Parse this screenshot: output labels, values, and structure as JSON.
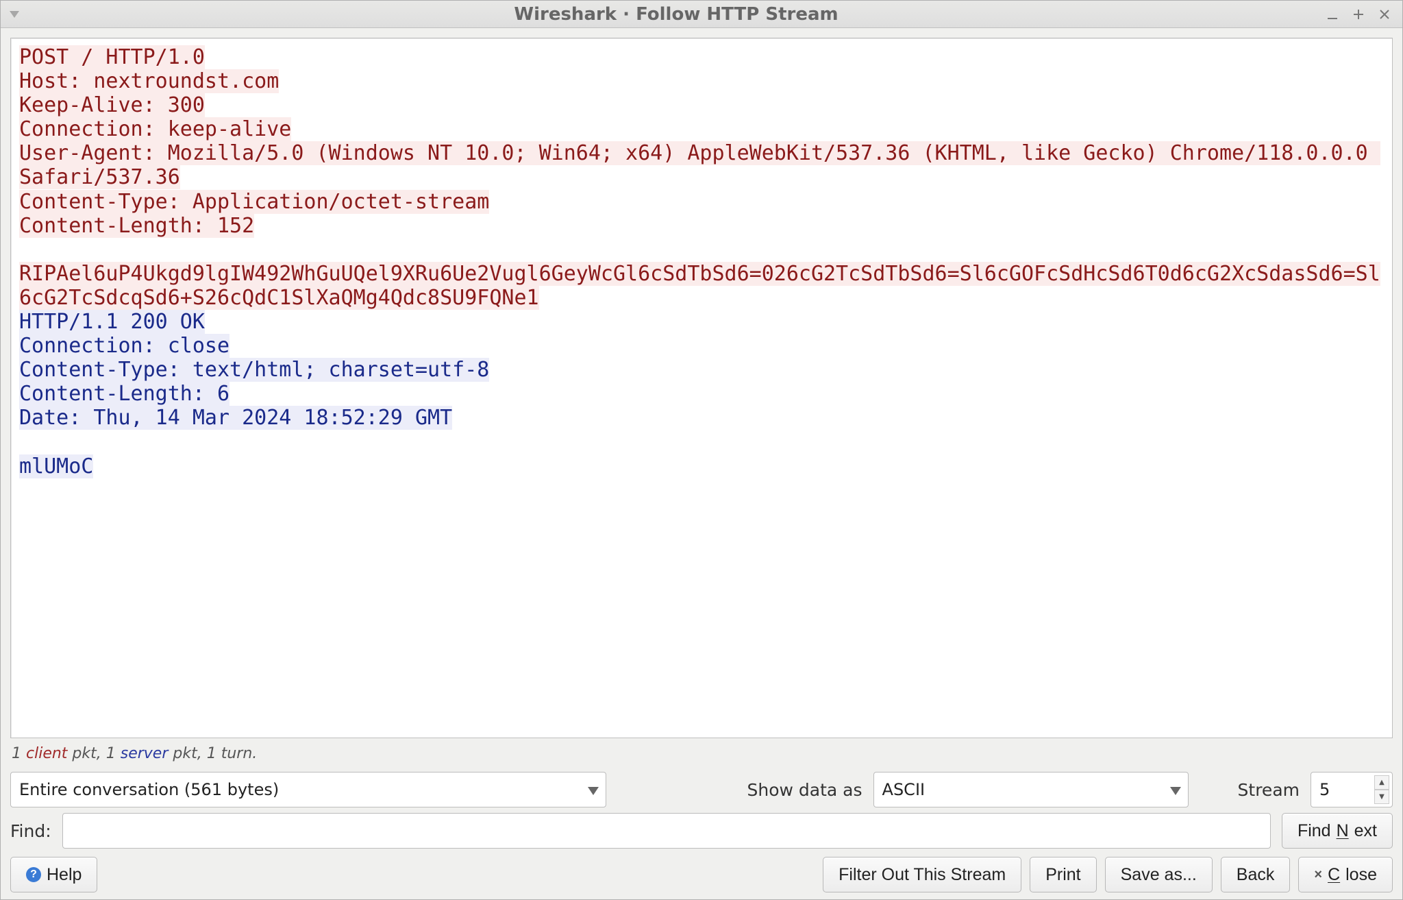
{
  "window": {
    "title": "Wireshark · Follow HTTP Stream"
  },
  "stream": {
    "client_lines": [
      "POST / HTTP/1.0",
      "Host: nextroundst.com",
      "Keep-Alive: 300",
      "Connection: keep-alive",
      "User-Agent: Mozilla/5.0 (Windows NT 10.0; Win64; x64) AppleWebKit/537.36 (KHTML, like Gecko) Chrome/118.0.0.0 Safari/537.36",
      "Content-Type: Application/octet-stream",
      "Content-Length: 152",
      "",
      "RIPAel6uP4Ukgd9lgIW492WhGuUQel9XRu6Ue2Vugl6GeyWcGl6cSdTbSd6=026cG2TcSdTbSd6=Sl6cGOFcSdHcSd6T0d6cG2XcSdasSd6=Sl6cG2TcSdcqSd6+S26cQdC1SlXaQMg4Qdc8SU9FQNe1"
    ],
    "server_lines": [
      "HTTP/1.1 200 OK",
      "Connection: close",
      "Content-Type: text/html; charset=utf-8",
      "Content-Length: 6",
      "Date: Thu, 14 Mar 2024 18:52:29 GMT",
      "",
      "mlUMoC"
    ]
  },
  "stats": {
    "client_pkts": "1",
    "client_label": "client",
    "mid1": " pkt, ",
    "server_pkts": "1",
    "server_label": "server",
    "tail": " pkt, 1 turn."
  },
  "controls": {
    "conversation_selected": "Entire conversation (561 bytes)",
    "show_data_label": "Show data as",
    "encoding_selected": "ASCII",
    "stream_label": "Stream",
    "stream_value": "5"
  },
  "find": {
    "label": "Find:",
    "value": "",
    "find_next_prefix": "Find ",
    "find_next_key": "N",
    "find_next_suffix": "ext"
  },
  "buttons": {
    "help": "Help",
    "filter_out": "Filter Out This Stream",
    "print": "Print",
    "save_as": "Save as...",
    "back": "Back",
    "close_prefix": "",
    "close_key": "C",
    "close_suffix": "lose"
  }
}
